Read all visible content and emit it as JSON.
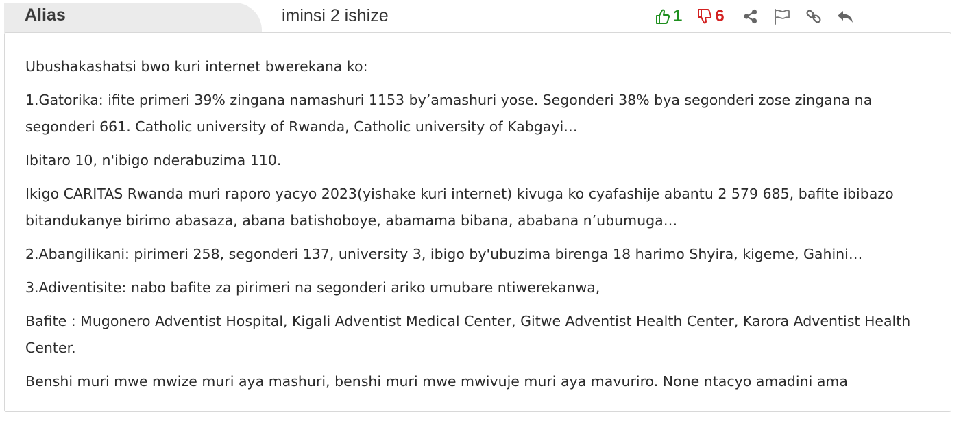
{
  "comment": {
    "author": "Alias",
    "time_ago": "iminsi 2 ishize",
    "likes": "1",
    "dislikes": "6",
    "paragraphs": [
      "Ubushakashatsi bwo kuri internet bwerekana ko:",
      "1.Gatorika: ifite primeri 39% zingana namashuri 1153 by’amashuri yose. Segonderi 38% bya segonderi zose zingana na segonderi 661. Catholic university of Rwanda, Catholic university of Kabgayi…",
      "Ibitaro 10, n'ibigo nderabuzima 110.",
      "Ikigo CARITAS Rwanda muri raporo yacyo 2023(yishake kuri internet) kivuga ko cyafashije abantu 2 579 685, bafite ibibazo bitandukanye birimo abasaza, abana batishoboye, abamama bibana, ababana n’ubumuga…",
      "2.Abangilikani: pirimeri 258, segonderi 137, university 3, ibigo by'ubuzima birenga 18 harimo Shyira, kigeme, Gahini…",
      "3.Adiventisite: nabo bafite za pirimeri na segonderi ariko umubare ntiwerekanwa,",
      "Bafite : Mugonero Adventist Hospital, Kigali Adventist Medical Center, Gitwe Adventist Health Center, Karora Adventist Health Center.",
      "Benshi muri mwe mwize muri aya mashuri, benshi muri mwe mwivuje muri aya mavuriro. None ntacyo amadini ama"
    ]
  },
  "icons": {
    "like": "thumbs-up-icon",
    "dislike": "thumbs-down-icon",
    "share": "share-icon",
    "flag": "flag-icon",
    "link": "link-icon",
    "reply": "reply-icon"
  },
  "colors": {
    "like": "#1e8f1e",
    "dislike": "#d32121",
    "icon_gray": "#666666",
    "author_tab_bg": "#ebebeb",
    "border": "#d8d8d8"
  }
}
